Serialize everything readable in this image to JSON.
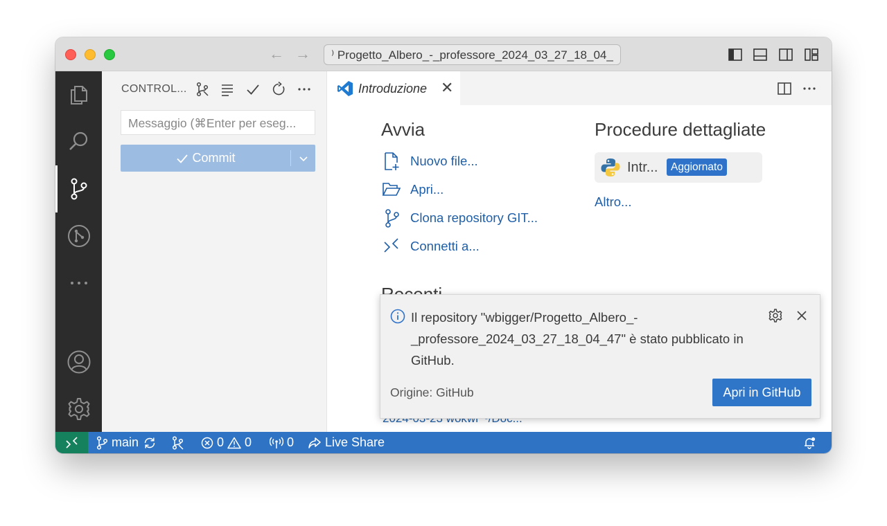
{
  "window": {
    "command_center_text": "⁾ Progetto_Albero_-_professore_2024_03_27_18_04_"
  },
  "sidebar": {
    "title": "CONTROL...",
    "message_placeholder": "Messaggio (⌘Enter per eseg...",
    "commit_label": "Commit"
  },
  "tabs": [
    {
      "label": "Introduzione"
    }
  ],
  "welcome": {
    "start_title": "Avvia",
    "start_items": [
      {
        "label": "Nuovo file..."
      },
      {
        "label": "Apri..."
      },
      {
        "label": "Clona repository GIT..."
      },
      {
        "label": "Connetti a..."
      }
    ],
    "walkthrough_title": "Procedure dettagliate",
    "walkthrough_item": "Intr...",
    "walkthrough_badge": "Aggiornato",
    "more_label": "Altro...",
    "recent_title": "Recenti",
    "recent_item": "2024-03-23 wokwi   ~/Doc..."
  },
  "notification": {
    "message": "Il repository \"wbigger/Progetto_Albero_-_professore_2024_03_27_18_04_47\" è stato pubblicato in GitHub.",
    "source": "Origine: GitHub",
    "action_label": "Apri in GitHub"
  },
  "statusbar": {
    "branch": "main",
    "errors": "0",
    "warnings": "0",
    "ports": "0",
    "live_share": "Live Share"
  }
}
